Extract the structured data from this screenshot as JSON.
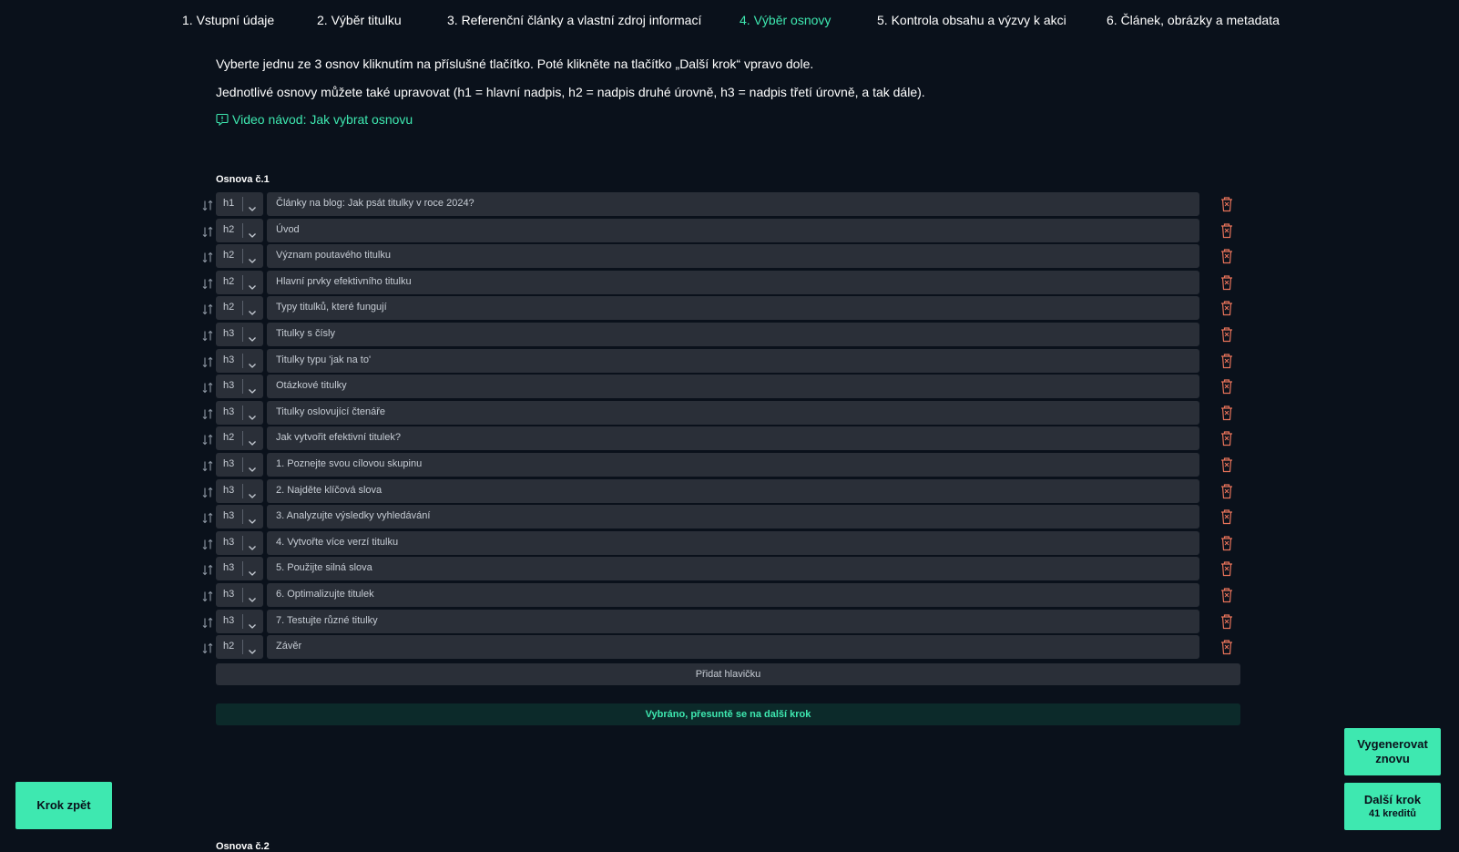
{
  "steps": [
    {
      "label": "1. Vstupní údaje",
      "active": false
    },
    {
      "label": "2. Výběr titulku",
      "active": false
    },
    {
      "label": "3. Referenční články a vlastní zdroj informací",
      "active": false
    },
    {
      "label": "4. Výběr osnovy",
      "active": true
    },
    {
      "label": "5. Kontrola obsahu a výzvy k akci",
      "active": false
    },
    {
      "label": "6. Článek, obrázky a metadata",
      "active": false
    }
  ],
  "intro": {
    "line1": "Vyberte jednu ze 3 osnov kliknutím na příslušné tlačítko. Poté klikněte na tlačítko „Další krok“ vpravo dole.",
    "line2": "Jednotlivé osnovy můžete také upravovat (h1 = hlavní nadpis, h2 = nadpis druhé úrovně, h3 = nadpis třetí úrovně, a tak dále).",
    "video_link": "Video návod: Jak vybrat osnovu"
  },
  "outline1": {
    "label": "Osnova č.1",
    "rows": [
      {
        "level": "h1",
        "text": "Články na blog: Jak psát titulky v roce 2024?"
      },
      {
        "level": "h2",
        "text": "Úvod"
      },
      {
        "level": "h2",
        "text": "Význam poutavého titulku"
      },
      {
        "level": "h2",
        "text": "Hlavní prvky efektivního titulku"
      },
      {
        "level": "h2",
        "text": "Typy titulků, které fungují"
      },
      {
        "level": "h3",
        "text": "Titulky s čísly"
      },
      {
        "level": "h3",
        "text": "Titulky typu 'jak na to'"
      },
      {
        "level": "h3",
        "text": "Otázkové titulky"
      },
      {
        "level": "h3",
        "text": "Titulky oslovující čtenáře"
      },
      {
        "level": "h2",
        "text": "Jak vytvořit efektivní titulek?"
      },
      {
        "level": "h3",
        "text": "1. Poznejte svou cílovou skupinu"
      },
      {
        "level": "h3",
        "text": "2. Najděte klíčová slova"
      },
      {
        "level": "h3",
        "text": "3. Analyzujte výsledky vyhledávání"
      },
      {
        "level": "h3",
        "text": "4. Vytvořte více verzí titulku"
      },
      {
        "level": "h3",
        "text": "5. Použijte silná slova"
      },
      {
        "level": "h3",
        "text": "6. Optimalizujte titulek"
      },
      {
        "level": "h3",
        "text": "7. Testujte různé titulky"
      },
      {
        "level": "h2",
        "text": "Závěr"
      }
    ],
    "add_button": "Přidat hlavičku",
    "selected_button": "Vybráno, přesuntě se na další krok"
  },
  "outline2": {
    "label": "Osnova č.2"
  },
  "buttons": {
    "back": "Krok zpět",
    "regenerate": "Vygenerovat znovu",
    "next": "Další krok",
    "next_credits": "41 kreditů"
  },
  "colors": {
    "background": "#0a111b",
    "accent": "#3ee8b0",
    "field": "#2a2f38",
    "delete": "#e8735a"
  },
  "icons": {
    "drag": "drag-handle-icon",
    "chevron": "chevron-down-icon",
    "delete": "trash-icon",
    "video": "info-bubble-icon"
  }
}
